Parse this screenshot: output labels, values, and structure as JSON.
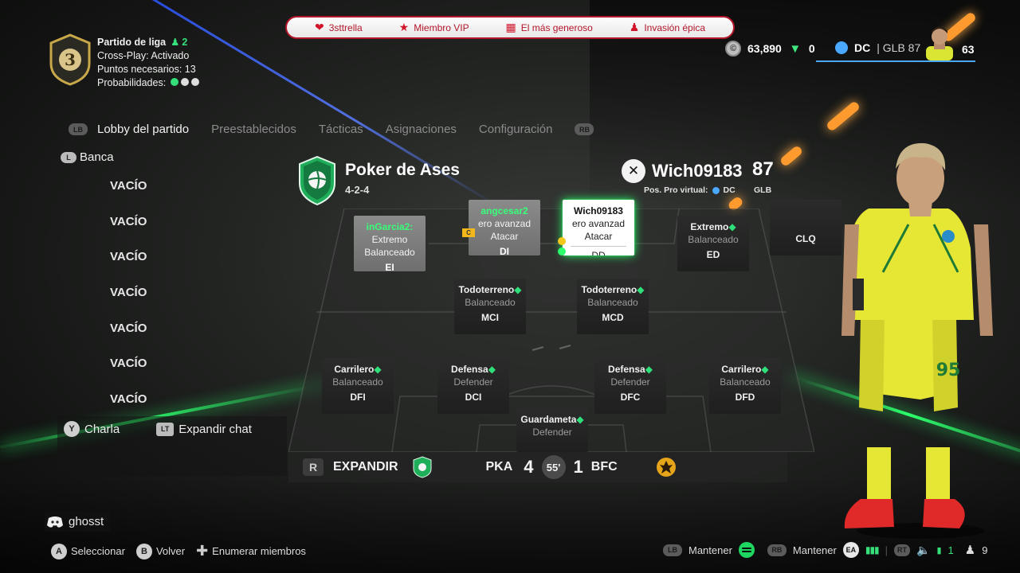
{
  "league": {
    "division": "3",
    "title": "Partido de liga",
    "players_count": "2",
    "crossplay": "Cross-Play: Activado",
    "points_needed": "Puntos necesarios: 13",
    "odds_label": "Probabilidades:"
  },
  "achievements": [
    {
      "icon": "heart-icon",
      "label": "3sttrella"
    },
    {
      "icon": "star-icon",
      "label": "Miembro VIP"
    },
    {
      "icon": "gift-icon",
      "label": "El más generoso"
    },
    {
      "icon": "group-icon",
      "label": "Invasión épica"
    }
  ],
  "currency": {
    "coins": "63,890",
    "points": "0",
    "position": "DC",
    "glb_label": "GLB",
    "glb_value": "87",
    "player_ovr": "63"
  },
  "tabs": {
    "lb": "LB",
    "rb": "RB",
    "items": [
      "Lobby del partido",
      "Preestablecidos",
      "Tácticas",
      "Asignaciones",
      "Configuración"
    ]
  },
  "bench": {
    "stick": "L",
    "title": "Banca",
    "slots": [
      "VACÍO",
      "VACÍO",
      "VACÍO",
      "VACÍO",
      "VACÍO",
      "VACÍO",
      "VACÍO"
    ]
  },
  "chat": {
    "talk_btn": "Y",
    "talk_label": "Charla",
    "expand_btn": "LT",
    "expand_label": "Expandir chat"
  },
  "discord": {
    "user": "ghosst"
  },
  "controls": {
    "select_btn": "A",
    "select_label": "Seleccionar",
    "back_btn": "B",
    "back_label": "Volver",
    "list_label": "Enumerar miembros",
    "lb": "LB",
    "hold1": "Mantener",
    "rb": "RB",
    "hold2": "Mantener",
    "rt": "RT",
    "voice_count": "1",
    "members_count": "9"
  },
  "team": {
    "name": "Poker de Ases",
    "formation": "4-2-4"
  },
  "user": {
    "name": "Wich09183",
    "ovr": "87",
    "pro_label": "Pos. Pro virtual:",
    "position": "DC",
    "glb": "GLB"
  },
  "formation_cards": [
    {
      "name": "inGarcia2:",
      "role": "Extremo",
      "style": "Balanceado",
      "pos": "EI",
      "variant": "grey"
    },
    {
      "name": "angcesar2",
      "role": "ero avanzad",
      "style": "Atacar",
      "pos": "DI",
      "variant": "grey"
    },
    {
      "name": "Wich09183",
      "role": "ero avanzad",
      "style": "Atacar",
      "pos": "DD",
      "variant": "white"
    },
    {
      "name": "",
      "role": "Extremo",
      "style": "Balanceado",
      "pos": "ED",
      "variant": "dark"
    },
    {
      "name": "",
      "role": "",
      "style": "",
      "pos": "CLQ",
      "variant": "dark"
    },
    {
      "name": "",
      "role": "Todoterreno",
      "style": "Balanceado",
      "pos": "MCI",
      "variant": "dark"
    },
    {
      "name": "",
      "role": "Todoterreno",
      "style": "Balanceado",
      "pos": "MCD",
      "variant": "dark"
    },
    {
      "name": "",
      "role": "Carrilero",
      "style": "Balanceado",
      "pos": "DFI",
      "variant": "dark"
    },
    {
      "name": "",
      "role": "Defensa",
      "style": "Defender",
      "pos": "DCI",
      "variant": "dark"
    },
    {
      "name": "",
      "role": "Defensa",
      "style": "Defender",
      "pos": "DFC",
      "variant": "dark"
    },
    {
      "name": "",
      "role": "Carrilero",
      "style": "Balanceado",
      "pos": "DFD",
      "variant": "dark"
    },
    {
      "name": "",
      "role": "Guardameta",
      "style": "Defender",
      "pos": "",
      "variant": "dark"
    }
  ],
  "captain_mark": "C",
  "match": {
    "expand_label": "EXPANDIR",
    "home": "PKA",
    "home_score": "4",
    "minute": "55'",
    "away_score": "1",
    "away": "BFC"
  },
  "colors": {
    "accent_green": "#2cff6c",
    "achievement_red": "#b3162a",
    "position_blue": "#4aa8ff"
  }
}
